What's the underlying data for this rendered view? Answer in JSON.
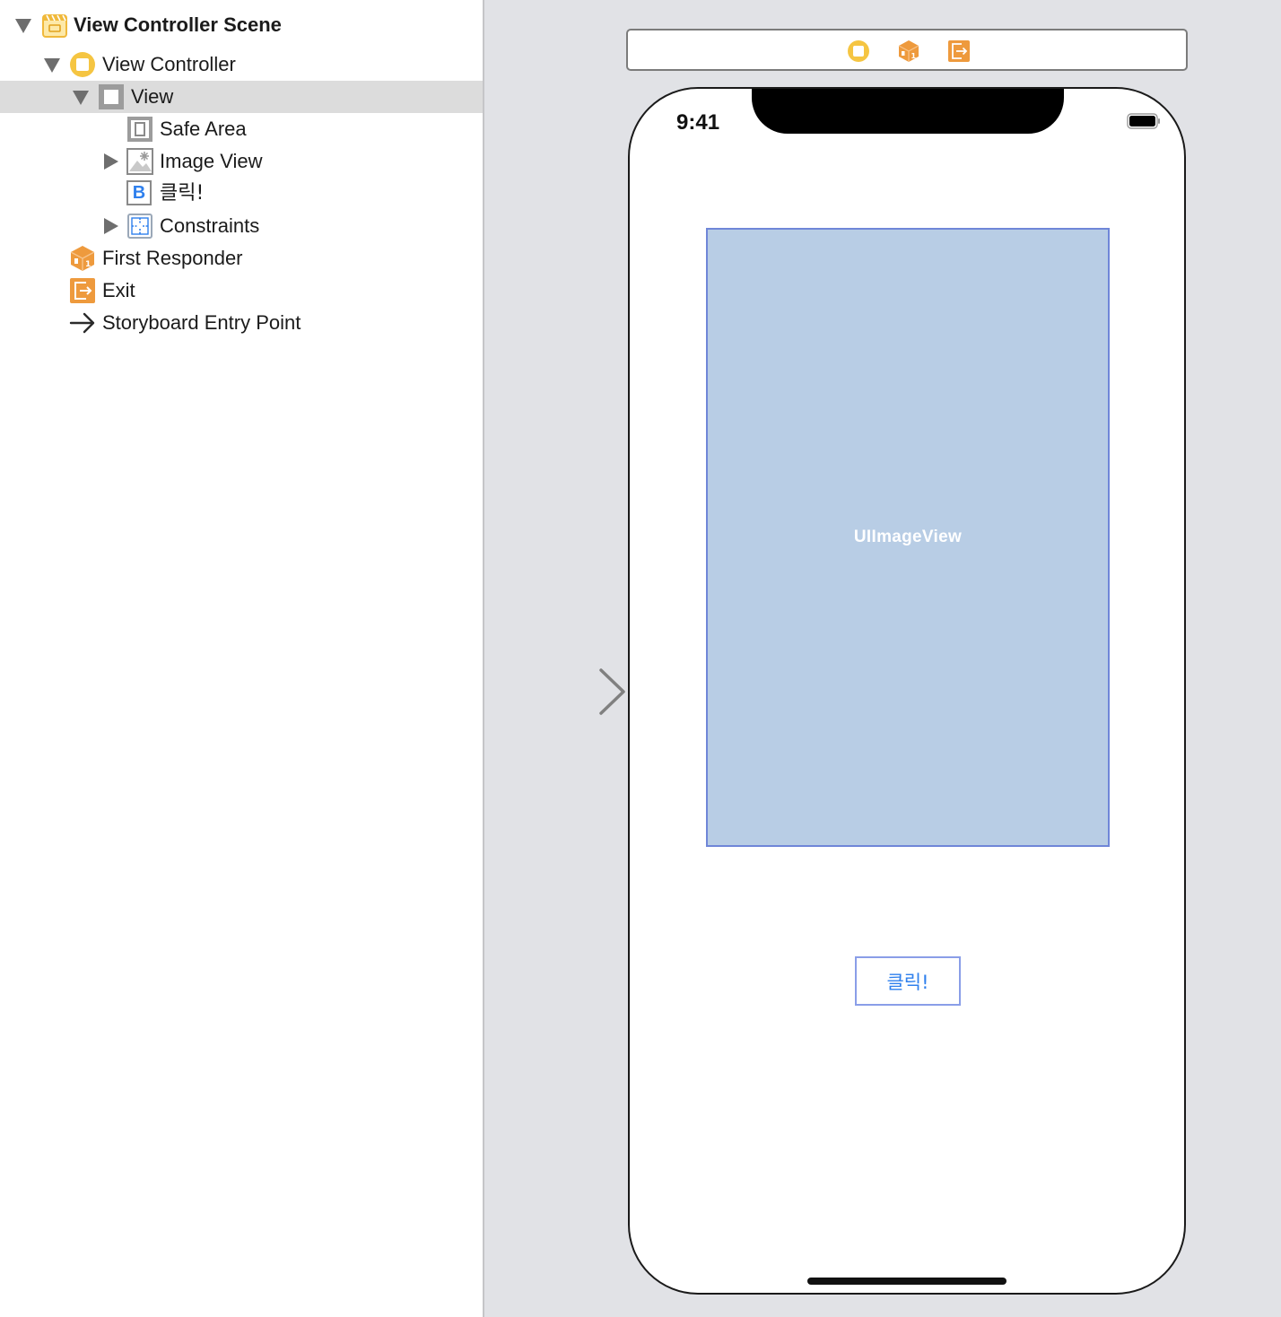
{
  "outline": {
    "items": [
      {
        "label": "View Controller Scene",
        "icon": "scene-icon",
        "disclosure": "open"
      },
      {
        "label": "View Controller",
        "icon": "view-controller-icon",
        "disclosure": "open"
      },
      {
        "label": "View",
        "icon": "view-icon",
        "disclosure": "open",
        "selected": true
      },
      {
        "label": "Safe Area",
        "icon": "safe-area-icon",
        "disclosure": "none"
      },
      {
        "label": "Image View",
        "icon": "image-view-icon",
        "disclosure": "closed"
      },
      {
        "label": "클릭!",
        "icon": "button-icon",
        "disclosure": "none",
        "icon_text": "B"
      },
      {
        "label": "Constraints",
        "icon": "constraints-icon",
        "disclosure": "closed"
      },
      {
        "label": "First Responder",
        "icon": "first-responder-icon",
        "disclosure": "none"
      },
      {
        "label": "Exit",
        "icon": "exit-icon",
        "disclosure": "none"
      },
      {
        "label": "Storyboard Entry Point",
        "icon": "entry-point-arrow-icon",
        "disclosure": "none"
      }
    ]
  },
  "canvas": {
    "dock_icons": [
      "view-controller-icon",
      "first-responder-icon",
      "exit-icon"
    ],
    "device": {
      "status_time": "9:41",
      "image_view_label": "UIImageView",
      "button_label": "클릭!"
    }
  },
  "colors": {
    "accent_yellow": "#f5c542",
    "accent_orange": "#ee9a3d",
    "button_text": "#2f80ed",
    "image_view_fill": "#b8cde5",
    "selection": "#dcdcdc"
  }
}
